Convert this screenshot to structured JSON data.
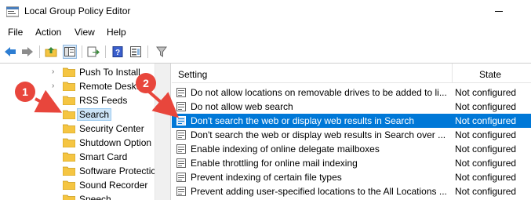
{
  "window": {
    "title": "Local Group Policy Editor",
    "icon": "policy-editor-icon"
  },
  "menu": [
    "File",
    "Action",
    "View",
    "Help"
  ],
  "toolbar": {
    "icons": [
      "back-arrow-icon",
      "forward-arrow-icon",
      "up-folder-icon",
      "show-hide-tree-icon",
      "export-list-icon",
      "help-icon",
      "properties-icon",
      "filter-icon"
    ]
  },
  "tree": {
    "items": [
      {
        "label": "Push To Install",
        "expandable": true
      },
      {
        "label": "Remote Deskt",
        "expandable": true
      },
      {
        "label": "RSS Feeds",
        "expandable": false
      },
      {
        "label": "Search",
        "expandable": false,
        "selected": true
      },
      {
        "label": "Security Center",
        "expandable": false
      },
      {
        "label": "Shutdown Option",
        "expandable": false
      },
      {
        "label": "Smart Card",
        "expandable": false
      },
      {
        "label": "Software Protectic",
        "expandable": false
      },
      {
        "label": "Sound Recorder",
        "expandable": false
      },
      {
        "label": "Speech",
        "expandable": false
      }
    ]
  },
  "list": {
    "columns": {
      "setting": "Setting",
      "state": "State"
    },
    "rows": [
      {
        "name": "Do not allow locations on removable drives to be added to li...",
        "state": "Not configured"
      },
      {
        "name": "Do not allow web search",
        "state": "Not configured"
      },
      {
        "name": "Don't search the web or display web results in Search",
        "state": "Not configured",
        "selected": true
      },
      {
        "name": "Don't search the web or display web results in Search over ...",
        "state": "Not configured"
      },
      {
        "name": "Enable indexing of online delegate mailboxes",
        "state": "Not configured"
      },
      {
        "name": "Enable throttling for online mail indexing",
        "state": "Not configured"
      },
      {
        "name": "Prevent indexing of certain file types",
        "state": "Not configured"
      },
      {
        "name": "Prevent adding user-specified locations to the All Locations ...",
        "state": "Not configured"
      }
    ]
  },
  "callouts": [
    "1",
    "2"
  ],
  "colors": {
    "callout": "#e8463c",
    "selection": "#0078d7",
    "folder": "#f5c542"
  }
}
